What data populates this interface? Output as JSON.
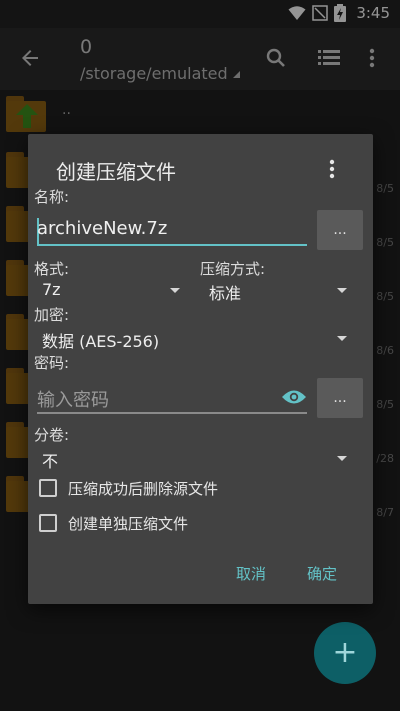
{
  "status": {
    "time": "3:45"
  },
  "appbar": {
    "title": "0",
    "path": "/storage/emulated"
  },
  "background": {
    "up_label": "..",
    "dates": [
      "8/5",
      "8/5",
      "8/5",
      "8/6",
      "8/5",
      "/28",
      "8/7"
    ]
  },
  "dialog": {
    "title": "创建压缩文件",
    "name_label": "名称:",
    "name_value": "archiveNew.7z",
    "browse_label": "...",
    "format_label": "格式:",
    "format_value": "7z",
    "method_label": "压缩方式:",
    "method_value": "标准",
    "encryption_label": "加密:",
    "encryption_value": "数据 (AES-256)",
    "password_label": "密码:",
    "password_placeholder": "输入密码",
    "password_browse_label": "...",
    "split_label": "分卷:",
    "split_value": "不",
    "delete_source_label": "压缩成功后删除源文件",
    "separate_archive_label": "创建单独压缩文件",
    "cancel_label": "取消",
    "ok_label": "确定"
  },
  "fab": {
    "symbol": "+"
  },
  "colors": {
    "accent": "#63c2c7",
    "fab": "#0d5f66",
    "dialog_bg": "#424242"
  }
}
